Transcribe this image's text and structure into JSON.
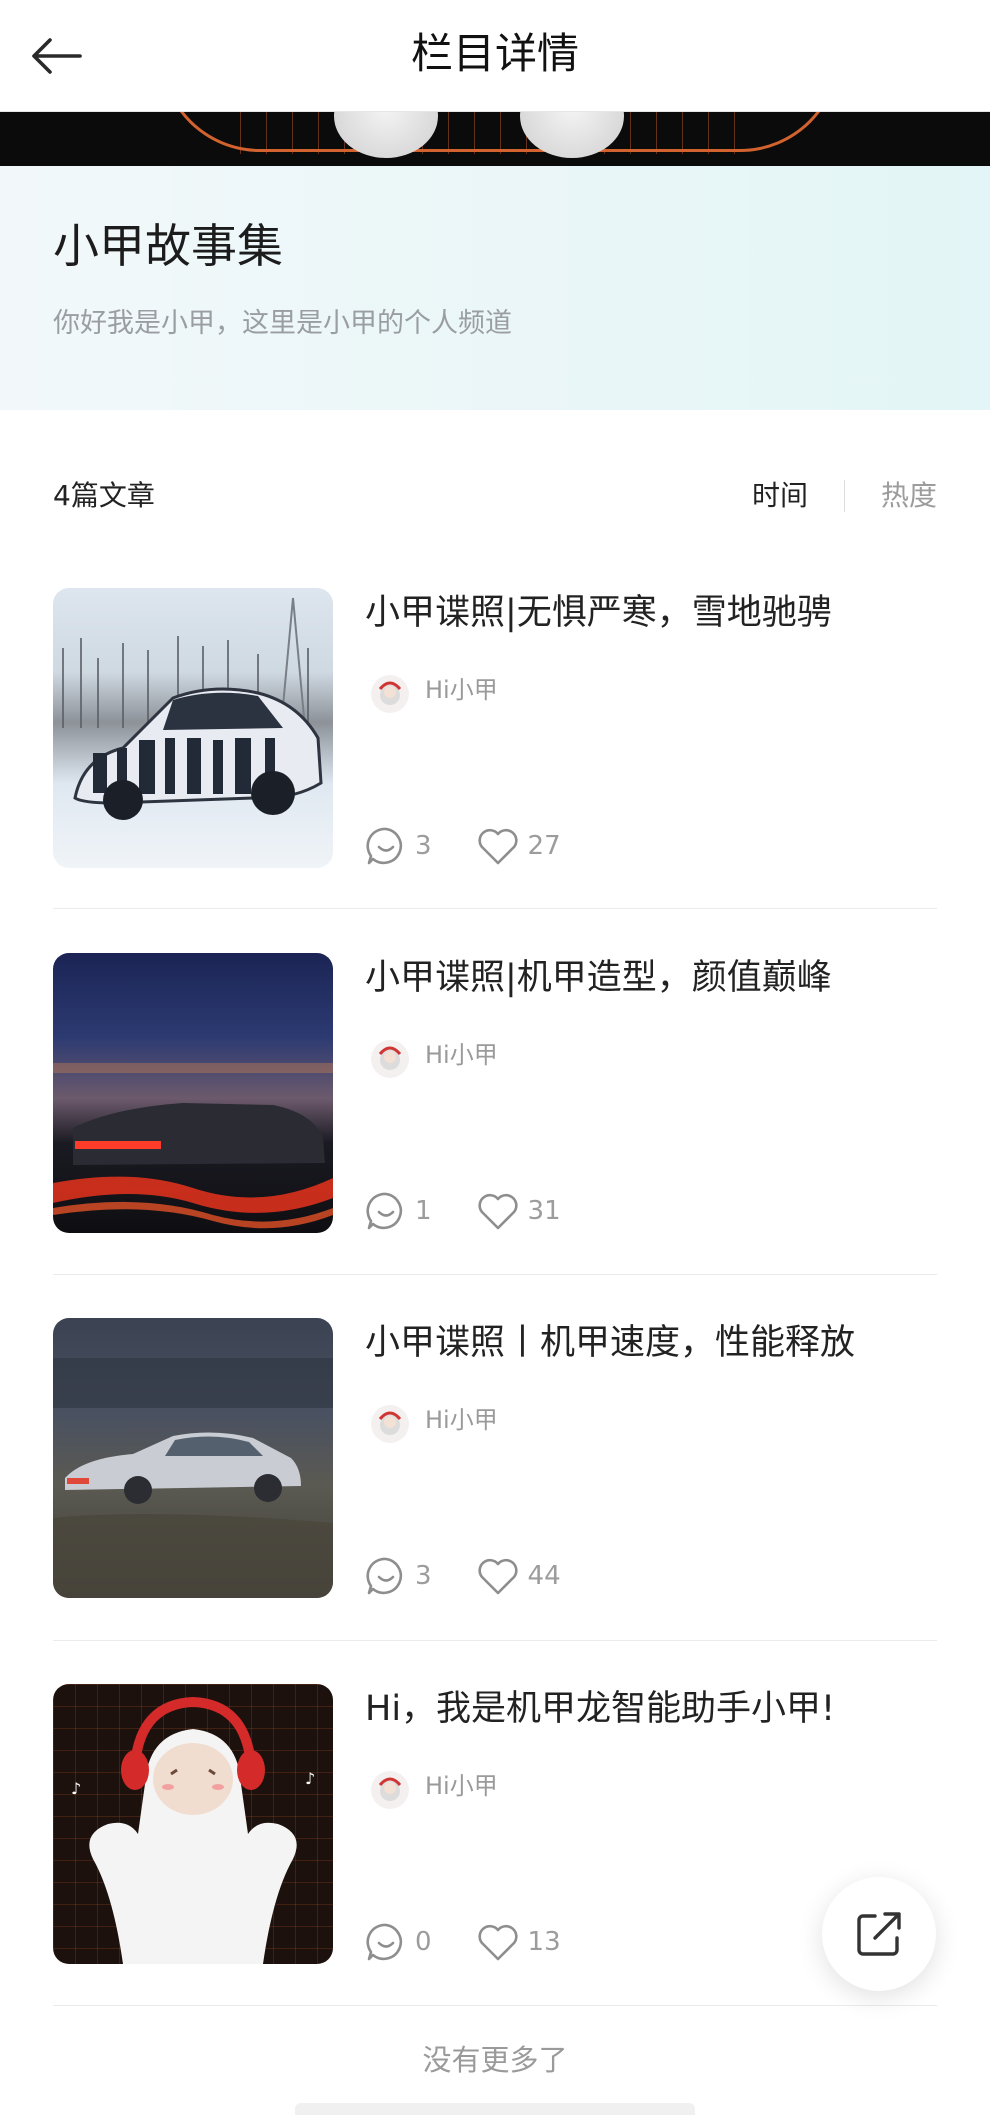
{
  "header": {
    "title": "栏目详情"
  },
  "column": {
    "title": "小甲故事集",
    "description": "你好我是小甲，这里是小甲的个人频道"
  },
  "list": {
    "count_label": "4篇文章",
    "sort_time": "时间",
    "sort_hot": "热度"
  },
  "articles": [
    {
      "title": "小甲谍照|无惧严寒，雪地驰骋",
      "author": "Hi小甲",
      "comments": "3",
      "likes": "27",
      "thumb": "camouflaged-car-in-snow"
    },
    {
      "title": "小甲谍照|机甲造型，颜值巅峰",
      "author": "Hi小甲",
      "comments": "1",
      "likes": "31",
      "thumb": "car-at-night-with-light-trails"
    },
    {
      "title": "小甲谍照丨机甲速度，性能释放",
      "author": "Hi小甲",
      "comments": "3",
      "likes": "44",
      "thumb": "silver-car-motion-blur"
    },
    {
      "title": "Hi，我是机甲龙智能助手小甲!",
      "author": "Hi小甲",
      "comments": "0",
      "likes": "13",
      "thumb": "white-mascot-with-red-headphones"
    }
  ],
  "footer": {
    "no_more": "没有更多了"
  },
  "icons": {
    "back": "arrow-left-icon",
    "comment": "comment-bubble-icon",
    "like": "heart-icon",
    "share": "share-external-icon"
  },
  "colors": {
    "header_bg_start": "#f2f8fa",
    "header_bg_end": "#e3f5f6",
    "muted_text": "#9c9c9c"
  }
}
